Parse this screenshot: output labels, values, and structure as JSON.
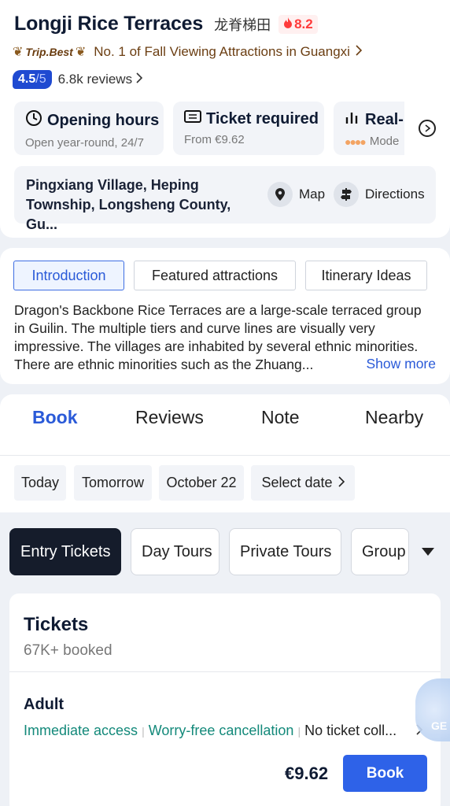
{
  "header": {
    "title": "Longji Rice Terraces",
    "cn_name": "龙脊梯田",
    "heat_score": "8.2",
    "trip_best_label": "Trip.Best",
    "ranking_text": "No. 1 of Fall Viewing Attractions in Guangxi",
    "rating": "4.5",
    "rating_denominator": "/5",
    "reviews": "6.8k reviews"
  },
  "info_cards": [
    {
      "title": "Opening hours",
      "subtitle": "Open year-round, 24/7",
      "icon": "clock-icon"
    },
    {
      "title": "Ticket required",
      "subtitle": "From €9.62",
      "icon": "ticket-icon"
    },
    {
      "title": "Real-",
      "subtitle": "Mode",
      "icon": "bar-chart-icon"
    }
  ],
  "address": {
    "line1": "Pingxiang Village, Heping",
    "line2": "Township, Longsheng County, Gu...",
    "map_label": "Map",
    "directions_label": "Directions"
  },
  "intro_tabs": [
    "Introduction",
    "Featured attractions",
    "Itinerary Ideas"
  ],
  "intro_text": "Dragon's Backbone Rice Terraces are a large-scale terraced group in Guilin. The multiple tiers and curve lines are visually very impressive. The villages are inhabited by several ethnic minorities. There are ethnic minorities such as the Zhuang...",
  "show_more": "Show more",
  "nav_tabs": [
    "Book",
    "Reviews",
    "Note",
    "Nearby"
  ],
  "dates": [
    "Today",
    "Tomorrow",
    "October 22",
    "Select date"
  ],
  "category_pills": [
    "Entry Tickets",
    "Day Tours",
    "Private Tours",
    "Group T"
  ],
  "tickets": {
    "title": "Tickets",
    "booked": "67K+ booked",
    "adult_label": "Adult",
    "feature1": "Immediate access",
    "feature2": "Worry-free cancellation",
    "feature3": "No ticket coll...",
    "price": "€9.62",
    "book_label": "Book"
  },
  "mascot_text": "GE"
}
